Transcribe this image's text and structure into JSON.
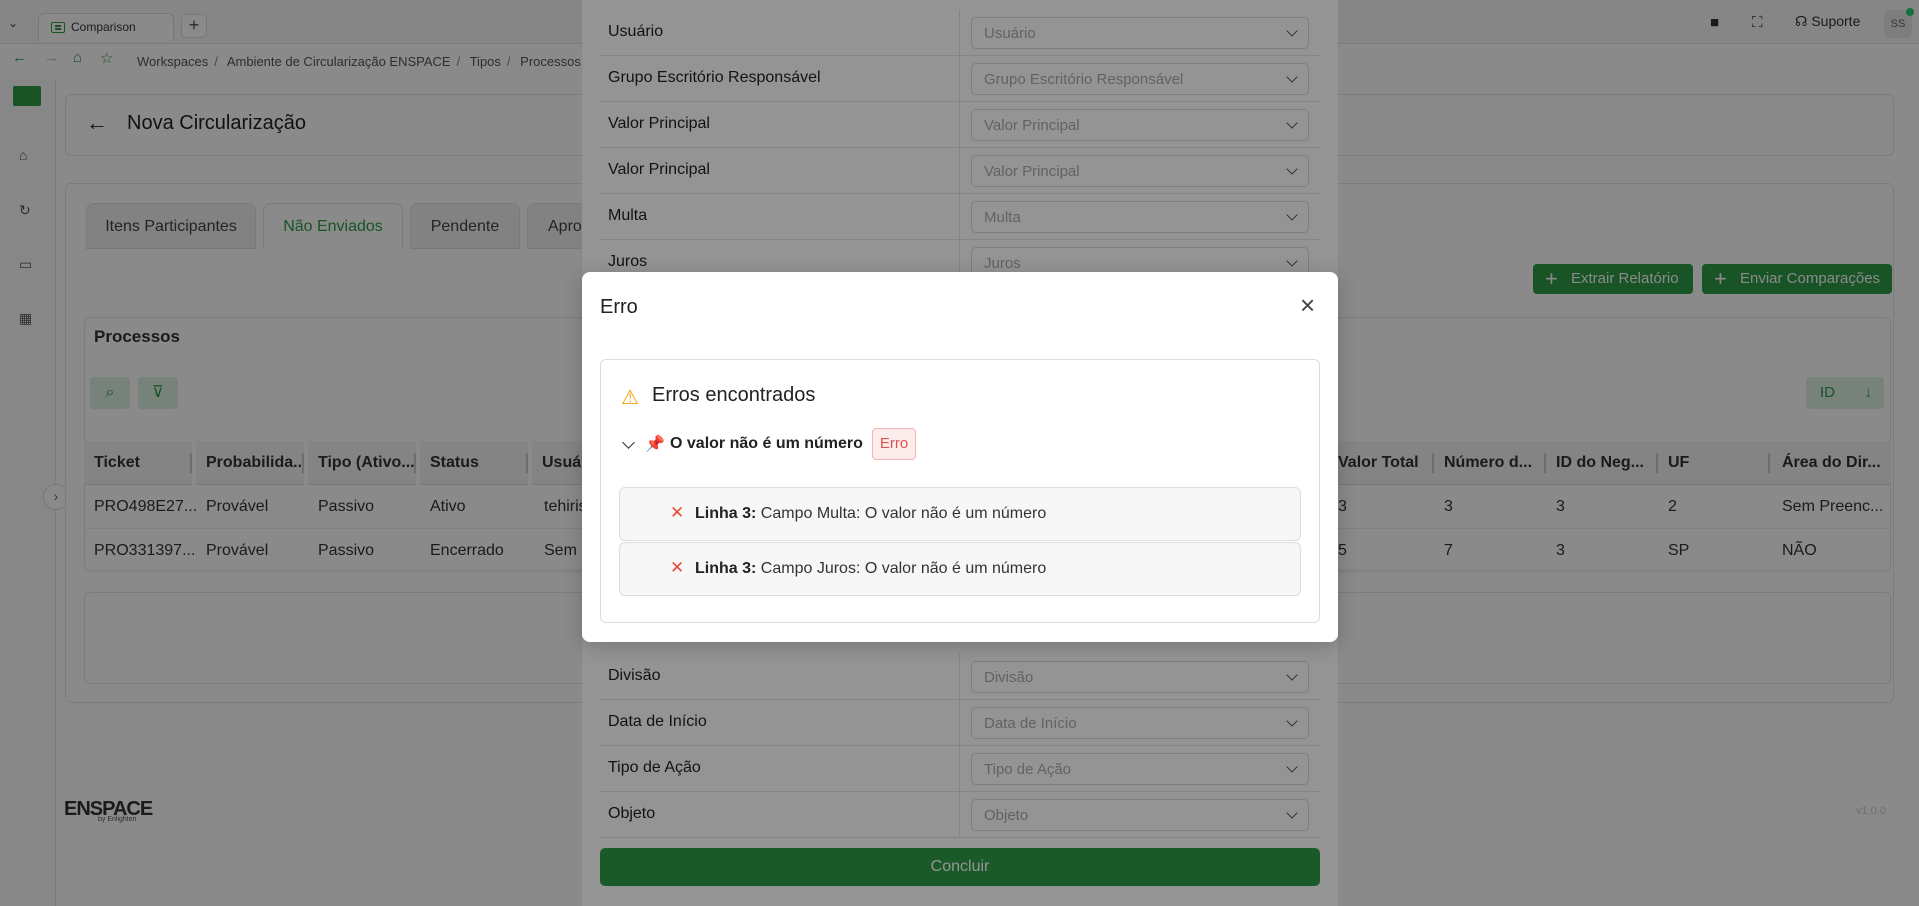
{
  "browser": {
    "tab_title": "Comparison",
    "new_tab": "+",
    "breadcrumb": [
      "Workspaces",
      "Ambiente de Circularização ENSPACE",
      "Tipos",
      "Processos"
    ],
    "support_label": "Suporte",
    "avatar_initials": "SS"
  },
  "sidebar": {
    "icons": [
      "home-icon",
      "refresh-icon",
      "file-icon",
      "calendar-icon"
    ],
    "brand": "ENSPACE",
    "brand_sub": "by Enlighten",
    "version": "v1.0.0"
  },
  "page": {
    "title": "Nova Circularização",
    "tabs": [
      {
        "label": "Itens Participantes",
        "active": false
      },
      {
        "label": "Não Enviados",
        "active": true
      },
      {
        "label": "Pendente",
        "active": false
      },
      {
        "label": "Apro",
        "active": false
      }
    ],
    "buttons": {
      "extract": "Extrair Relatório",
      "send": "Enviar Comparações"
    },
    "section_title": "Processos",
    "sort_label": "ID"
  },
  "table": {
    "left_columns": [
      "Ticket",
      "Probabilida...",
      "Tipo (Ativo...",
      "Status",
      "Usuá"
    ],
    "right_columns": [
      "Valor Total",
      "Número d...",
      "ID do Neg...",
      "UF",
      "Área do Dir..."
    ],
    "rows": [
      {
        "left": [
          "PRO498E27...",
          "Provável",
          "Passivo",
          "Ativo",
          "tehiris"
        ],
        "right": [
          "3",
          "3",
          "3",
          "2",
          "Sem Preenc..."
        ]
      },
      {
        "left": [
          "PRO331397...",
          "Provável",
          "Passivo",
          "Encerrado",
          "Sem P"
        ],
        "right": [
          "5",
          "7",
          "3",
          "SP",
          "NÃO"
        ]
      }
    ]
  },
  "form": {
    "fields": [
      {
        "label": "Usuário",
        "placeholder": "Usuário"
      },
      {
        "label": "Grupo Escritório Responsável",
        "placeholder": "Grupo Escritório Responsável"
      },
      {
        "label": "Valor Principal",
        "placeholder": "Valor Principal"
      },
      {
        "label": "Valor Principal",
        "placeholder": "Valor Principal"
      },
      {
        "label": "Multa",
        "placeholder": "Multa"
      },
      {
        "label": "Juros",
        "placeholder": "Juros"
      },
      {
        "label": "Divisão",
        "placeholder": "Divisão"
      },
      {
        "label": "Data de Início",
        "placeholder": "Data de Início"
      },
      {
        "label": "Tipo de Ação",
        "placeholder": "Tipo de Ação"
      },
      {
        "label": "Objeto",
        "placeholder": "Objeto"
      }
    ],
    "submit": "Concluir"
  },
  "modal": {
    "title": "Erro",
    "close": "×",
    "heading": "Erros encontrados",
    "group_title": "O valor não é um número",
    "badge": "Erro",
    "errors": [
      {
        "line": "Linha 3:",
        "message": "Campo Multa: O valor não é um número"
      },
      {
        "line": "Linha 3:",
        "message": "Campo Juros: O valor não é um número"
      }
    ]
  },
  "colors": {
    "accent": "#2d9c46",
    "error": "#e74c3c",
    "warning": "#f0a000"
  }
}
